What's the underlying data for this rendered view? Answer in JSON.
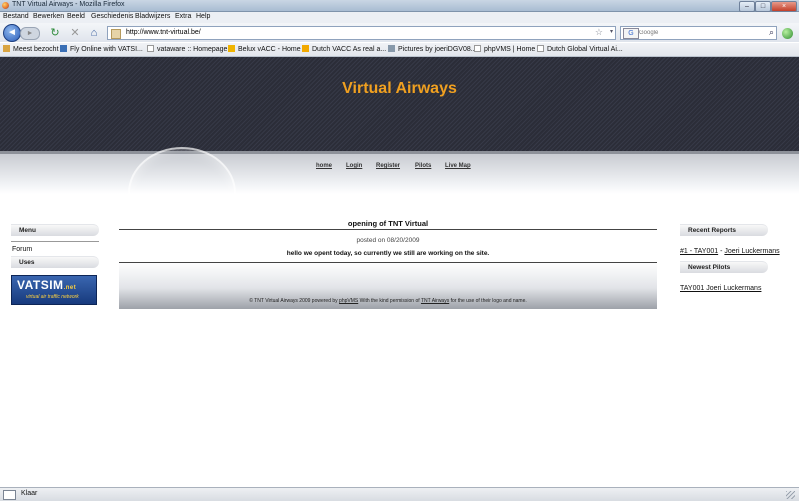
{
  "window": {
    "title": "TNT Virtual Airways - Mozilla Firefox",
    "min": "–",
    "max": "□",
    "close": "×"
  },
  "menu": [
    "Bestand",
    "Bewerken",
    "Beeld",
    "Geschiedenis",
    "Bladwijzers",
    "Extra",
    "Help"
  ],
  "navbar": {
    "back": "◄",
    "forward": "►",
    "reload": "↻",
    "stop": "✕",
    "home": "⌂",
    "url": "http://www.tnt-virtual.be/",
    "star": "☆",
    "dropdown": "▾",
    "search_engine": "G",
    "search_placeholder": "Google",
    "search_go": "⌕"
  },
  "bookmarks": [
    {
      "label": "Meest bezocht",
      "color": "#d9a441"
    },
    {
      "label": "Fly Online with VATSI...",
      "color": "#3a6fb5"
    },
    {
      "label": "vataware :: Homepage",
      "color": "#ffffff"
    },
    {
      "label": "Belux vACC - Home",
      "color": "#f0b400"
    },
    {
      "label": "Dutch VACC  As real a...",
      "color": "#f2a900"
    },
    {
      "label": "Pictures by joeriDGV08...",
      "color": "#8899aa"
    },
    {
      "label": "phpVMS | Home",
      "color": "#ffffff"
    },
    {
      "label": "Dutch Global Virtual Ai...",
      "color": "#ffffff"
    }
  ],
  "site": {
    "title": "Virtual Airways",
    "nav": [
      "home",
      "Login",
      "Register",
      "Pilots",
      "Live Map"
    ]
  },
  "left_sidebar": {
    "menu_heading": "Menu",
    "menu_item": "Forum",
    "uses_heading": "Uses",
    "banner_main": "VATSIM",
    "banner_suffix": ".net",
    "banner_tagline": "virtual air traffic network"
  },
  "post": {
    "title": "opening of TNT Virtual",
    "meta": "posted on 08/20/2009",
    "body": "hello we opent today, so currently we still are working on the site."
  },
  "footer": {
    "prefix": "© TNT Virtual Airways 2009 powered by",
    "link1": "phpVMS",
    "middle": "With the kind permission of",
    "link2": "TNT Airways",
    "suffix": "for the use of their logo and name."
  },
  "right_sidebar": {
    "reports_heading": "Recent Reports",
    "report_link": "#1 - TAY001",
    "report_sep": " - ",
    "report_pilot": "Joeri Luckermans",
    "pilots_heading": "Newest Pilots",
    "pilot_link": "TAY001 Joeri Luckermans"
  },
  "status": {
    "text": "Klaar"
  },
  "colors": {
    "site_title": "#f0a020",
    "header_bg": "#2b2d38"
  }
}
